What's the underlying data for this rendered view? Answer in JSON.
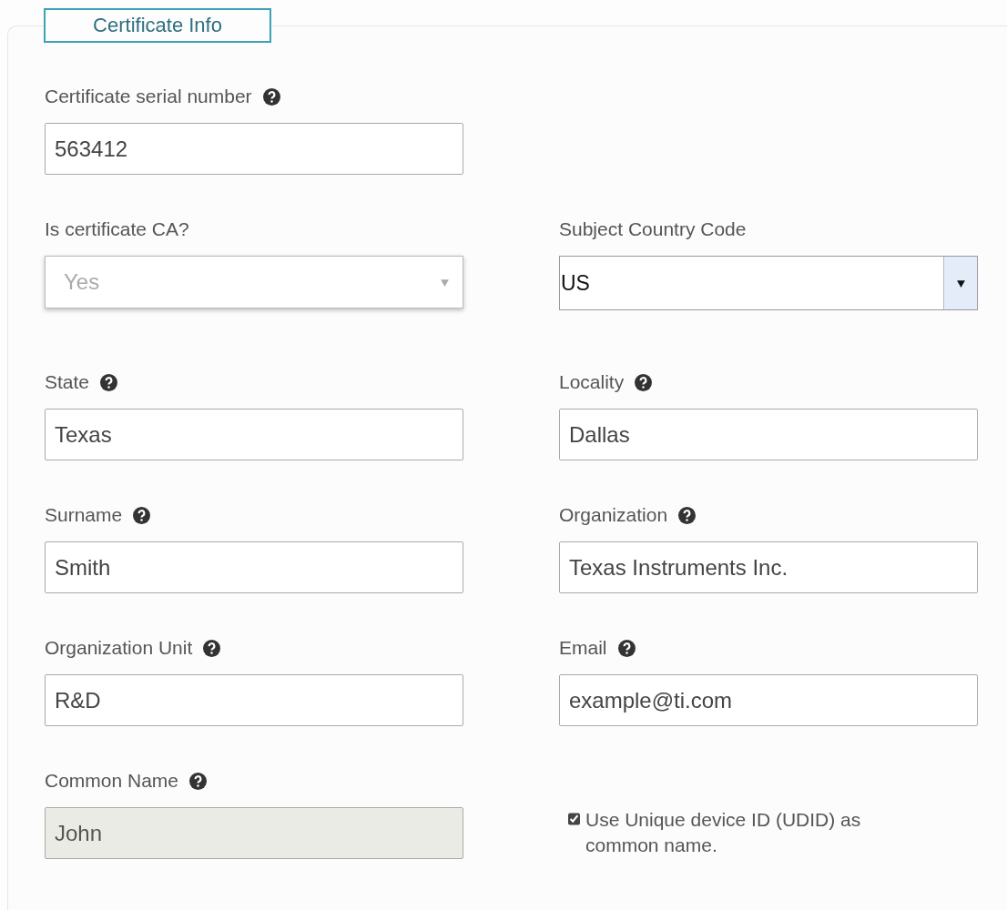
{
  "panel": {
    "legend": "Certificate Info"
  },
  "rows": [
    [
      {
        "kind": "text",
        "label": "Certificate serial number",
        "help": true,
        "value": "563412",
        "disabled": false
      }
    ],
    [
      {
        "kind": "select",
        "label": "Is certificate CA?",
        "help": false,
        "value": "Yes",
        "disabled": true
      },
      {
        "kind": "native-select",
        "label": "Subject Country Code",
        "help": false,
        "value": "US",
        "disabled": false
      }
    ],
    [
      {
        "kind": "text",
        "label": "State",
        "help": true,
        "value": "Texas",
        "disabled": false
      },
      {
        "kind": "text",
        "label": "Locality",
        "help": true,
        "value": "Dallas",
        "disabled": false
      }
    ],
    [
      {
        "kind": "text",
        "label": "Surname",
        "help": true,
        "value": "Smith",
        "disabled": false
      },
      {
        "kind": "text",
        "label": "Organization",
        "help": true,
        "value": "Texas Instruments Inc.",
        "disabled": false
      }
    ],
    [
      {
        "kind": "text",
        "label": "Organization Unit",
        "help": true,
        "value": "R&D",
        "disabled": false
      },
      {
        "kind": "text",
        "label": "Email",
        "help": true,
        "value": "example@ti.com",
        "disabled": false
      }
    ],
    [
      {
        "kind": "text",
        "label": "Common Name",
        "help": true,
        "value": "John",
        "disabled": true
      },
      {
        "kind": "checkbox",
        "label": "Use Unique device ID (UDID) as common name.",
        "checked": true
      }
    ]
  ]
}
